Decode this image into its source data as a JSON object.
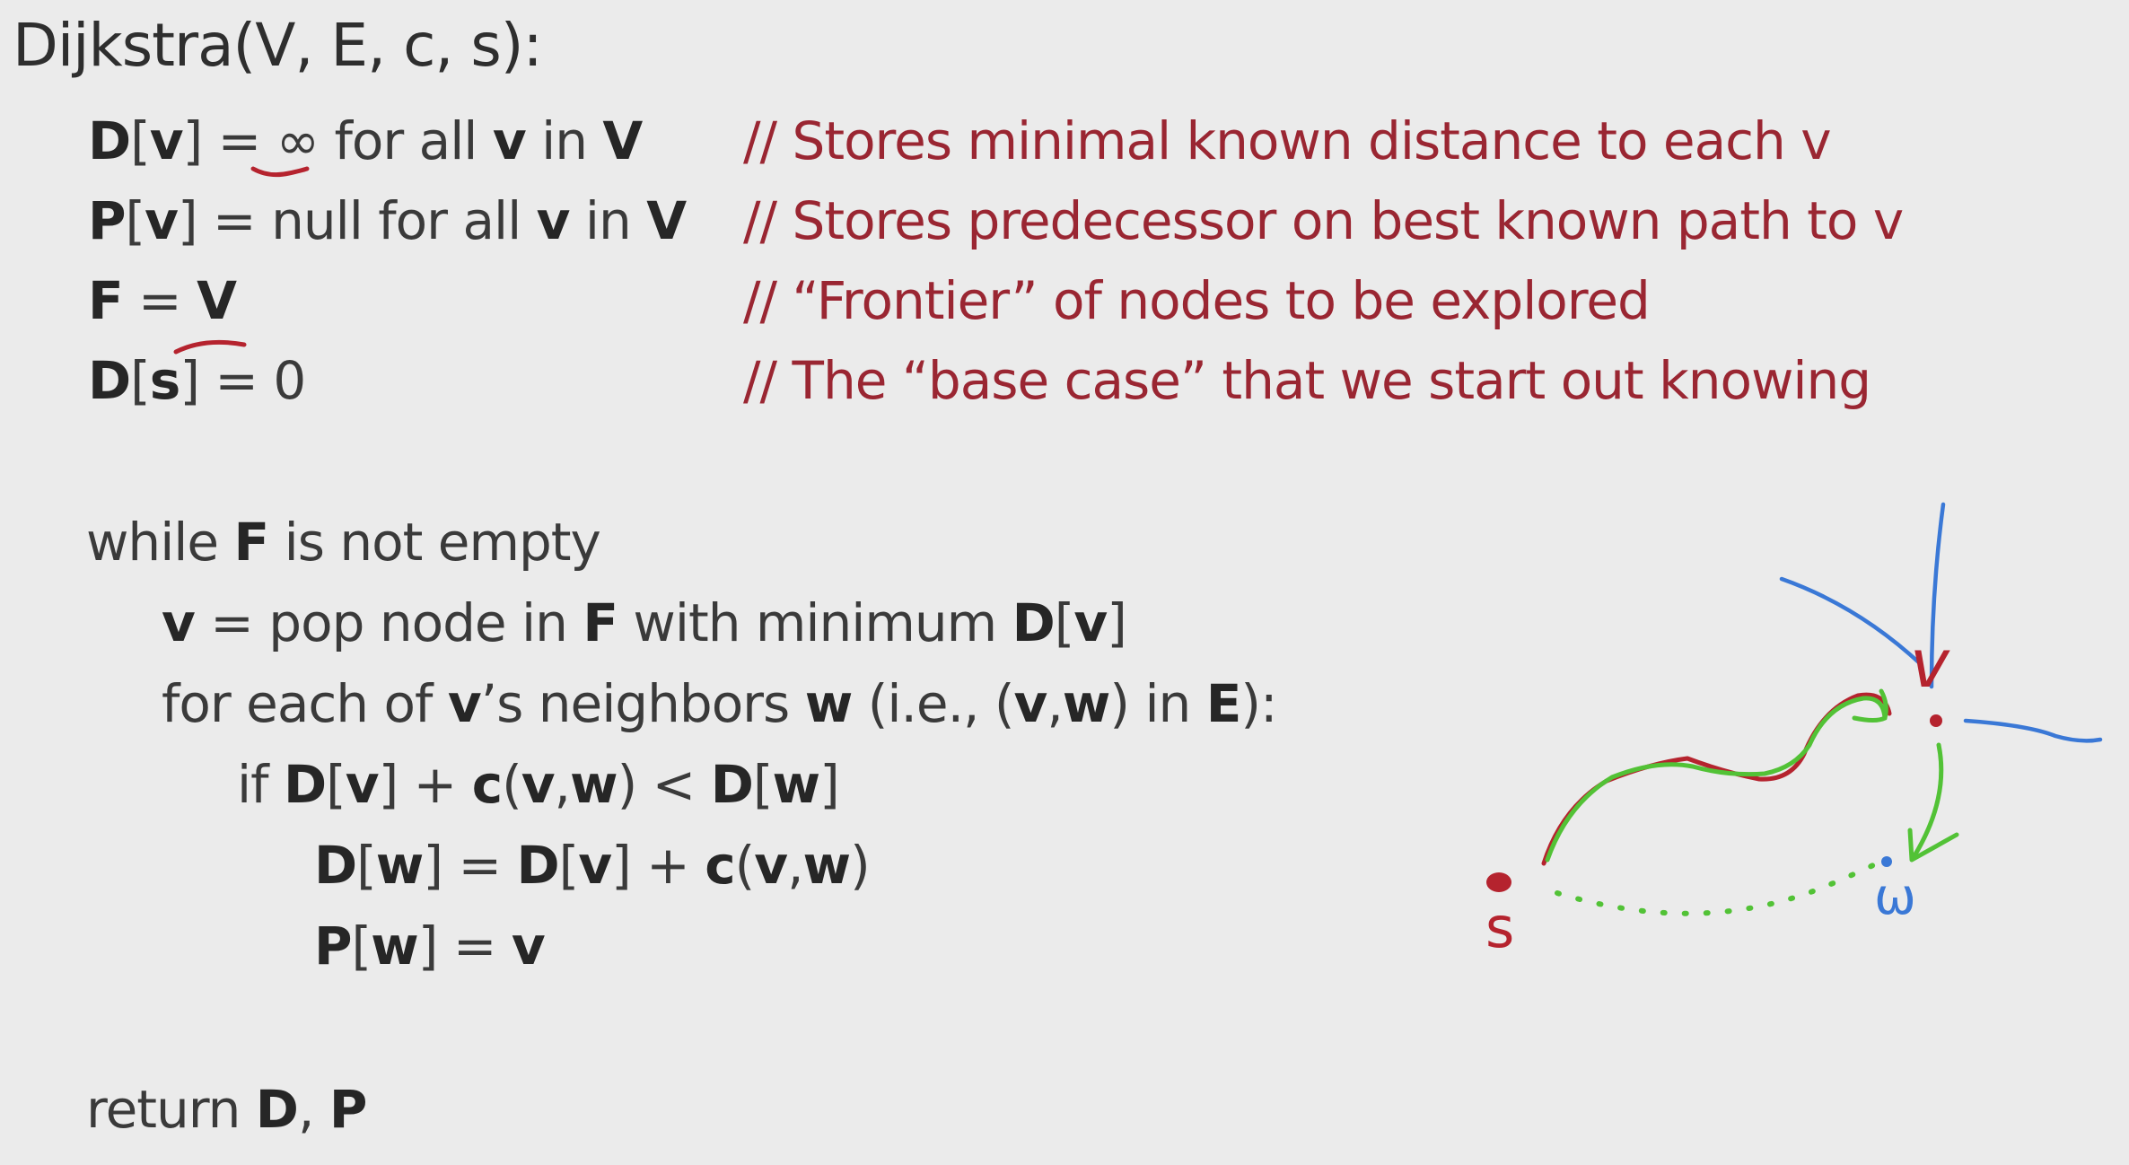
{
  "title": "Dijkstra(V, E, c, s):",
  "init": [
    {
      "parts": [
        {
          "t": "D",
          "b": true
        },
        {
          "t": "[",
          "b": false
        },
        {
          "t": "v",
          "b": true
        },
        {
          "t": "] = ∞ for all ",
          "b": false
        },
        {
          "t": "v",
          "b": true
        },
        {
          "t": " in ",
          "b": false
        },
        {
          "t": "V",
          "b": true
        }
      ],
      "comment": "// Stores minimal known distance to each v"
    },
    {
      "parts": [
        {
          "t": "P",
          "b": true
        },
        {
          "t": "[",
          "b": false
        },
        {
          "t": "v",
          "b": true
        },
        {
          "t": "] = null for all ",
          "b": false
        },
        {
          "t": "v",
          "b": true
        },
        {
          "t": " in ",
          "b": false
        },
        {
          "t": "V",
          "b": true
        }
      ],
      "comment": "// Stores predecessor on best known path to v"
    },
    {
      "parts": [
        {
          "t": "F",
          "b": true
        },
        {
          "t": " = ",
          "b": false
        },
        {
          "t": "V",
          "b": true
        }
      ],
      "comment": "// “Frontier” of nodes to be explored"
    },
    {
      "parts": [
        {
          "t": "D",
          "b": true
        },
        {
          "t": "[",
          "b": false
        },
        {
          "t": "s",
          "b": true
        },
        {
          "t": "] = 0",
          "b": false
        }
      ],
      "comment": "// The “base case” that we start out knowing"
    }
  ],
  "loop": [
    {
      "parts": [
        {
          "t": "while ",
          "b": false
        },
        {
          "t": "F",
          "b": true
        },
        {
          "t": " is not empty",
          "b": false
        }
      ]
    },
    {
      "parts": [
        {
          "t": "v",
          "b": true
        },
        {
          "t": " = pop node in ",
          "b": false
        },
        {
          "t": "F",
          "b": true
        },
        {
          "t": " with minimum ",
          "b": false
        },
        {
          "t": "D",
          "b": true
        },
        {
          "t": "[",
          "b": false
        },
        {
          "t": "v",
          "b": true
        },
        {
          "t": "]",
          "b": false
        }
      ]
    },
    {
      "parts": [
        {
          "t": "for each of ",
          "b": false
        },
        {
          "t": "v",
          "b": true
        },
        {
          "t": "’s neighbors ",
          "b": false
        },
        {
          "t": "w",
          "b": true
        },
        {
          "t": " (i.e., (",
          "b": false
        },
        {
          "t": "v",
          "b": true
        },
        {
          "t": ",",
          "b": false
        },
        {
          "t": "w",
          "b": true
        },
        {
          "t": ") in ",
          "b": false
        },
        {
          "t": "E",
          "b": true
        },
        {
          "t": "):",
          "b": false
        }
      ]
    },
    {
      "parts": [
        {
          "t": "if ",
          "b": false
        },
        {
          "t": "D",
          "b": true
        },
        {
          "t": "[",
          "b": false
        },
        {
          "t": "v",
          "b": true
        },
        {
          "t": "] + ",
          "b": false
        },
        {
          "t": "c",
          "b": true
        },
        {
          "t": "(",
          "b": false
        },
        {
          "t": "v",
          "b": true
        },
        {
          "t": ",",
          "b": false
        },
        {
          "t": "w",
          "b": true
        },
        {
          "t": ") < ",
          "b": false
        },
        {
          "t": "D",
          "b": true
        },
        {
          "t": "[",
          "b": false
        },
        {
          "t": "w",
          "b": true
        },
        {
          "t": "]",
          "b": false
        }
      ]
    },
    {
      "parts": [
        {
          "t": "D",
          "b": true
        },
        {
          "t": "[",
          "b": false
        },
        {
          "t": "w",
          "b": true
        },
        {
          "t": "] = ",
          "b": false
        },
        {
          "t": "D",
          "b": true
        },
        {
          "t": "[",
          "b": false
        },
        {
          "t": "v",
          "b": true
        },
        {
          "t": "] + ",
          "b": false
        },
        {
          "t": "c",
          "b": true
        },
        {
          "t": "(",
          "b": false
        },
        {
          "t": "v",
          "b": true
        },
        {
          "t": ",",
          "b": false
        },
        {
          "t": "w",
          "b": true
        },
        {
          "t": ")",
          "b": false
        }
      ]
    },
    {
      "parts": [
        {
          "t": "P",
          "b": true
        },
        {
          "t": "[",
          "b": false
        },
        {
          "t": "w",
          "b": true
        },
        {
          "t": "] = ",
          "b": false
        },
        {
          "t": "v",
          "b": true
        }
      ]
    }
  ],
  "return_line": {
    "parts": [
      {
        "t": "return ",
        "b": false
      },
      {
        "t": "D",
        "b": true
      },
      {
        "t": ", ",
        "b": false
      },
      {
        "t": "P",
        "b": true
      }
    ]
  },
  "sketch": {
    "label_s": "s",
    "label_v": "v",
    "label_w": "ω",
    "colors": {
      "red": "#b5232e",
      "green": "#52c236",
      "blue": "#3a78d6",
      "comment": "#9a2632"
    }
  }
}
